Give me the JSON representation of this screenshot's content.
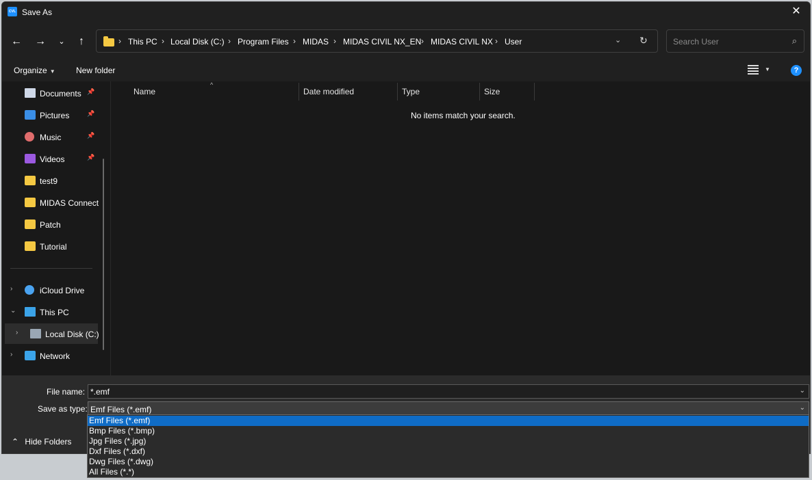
{
  "window": {
    "title": "Save As",
    "app_icon_text": "CVL"
  },
  "address": {
    "crumbs": [
      "This PC",
      "Local Disk (C:)",
      "Program Files",
      "MIDAS",
      "MIDAS CIVIL NX_EN",
      "MIDAS CIVIL NX",
      "User"
    ]
  },
  "search": {
    "placeholder": "Search User"
  },
  "toolbar": {
    "organize": "Organize",
    "new_folder": "New folder",
    "help": "?"
  },
  "sidebar": {
    "quick": [
      {
        "label": "Documents",
        "pinned": true,
        "icon": "documents-icon"
      },
      {
        "label": "Pictures",
        "pinned": true,
        "icon": "pictures-icon"
      },
      {
        "label": "Music",
        "pinned": true,
        "icon": "music-icon"
      },
      {
        "label": "Videos",
        "pinned": true,
        "icon": "videos-icon"
      },
      {
        "label": "test9",
        "pinned": false,
        "icon": "folder-icon"
      },
      {
        "label": "MIDAS Connect",
        "pinned": false,
        "icon": "folder-icon"
      },
      {
        "label": "Patch",
        "pinned": false,
        "icon": "folder-icon"
      },
      {
        "label": "Tutorial",
        "pinned": false,
        "icon": "folder-icon"
      }
    ],
    "tree": [
      {
        "label": "iCloud Drive",
        "icon": "cloud-icon"
      },
      {
        "label": "This PC",
        "icon": "pc-icon"
      },
      {
        "label": "Local Disk (C:)",
        "icon": "disk-icon"
      },
      {
        "label": "Network",
        "icon": "network-icon"
      }
    ]
  },
  "columns": {
    "name": "Name",
    "date": "Date modified",
    "type": "Type",
    "size": "Size"
  },
  "content": {
    "empty_message": "No items match your search."
  },
  "form": {
    "file_name_label": "File name:",
    "file_name_value": "*.emf",
    "save_type_label": "Save as type:",
    "save_type_value": "Emf Files (*.emf)",
    "hide_folders": "Hide Folders"
  },
  "type_options": [
    "Emf Files (*.emf)",
    "Bmp Files (*.bmp)",
    "Jpg Files (*.jpg)",
    "Dxf Files (*.dxf)",
    "Dwg Files (*.dwg)",
    "All Files (*.*)"
  ],
  "colors": {
    "accent": "#0f6cc6",
    "folder": "#f4c842",
    "background": "#191919"
  }
}
